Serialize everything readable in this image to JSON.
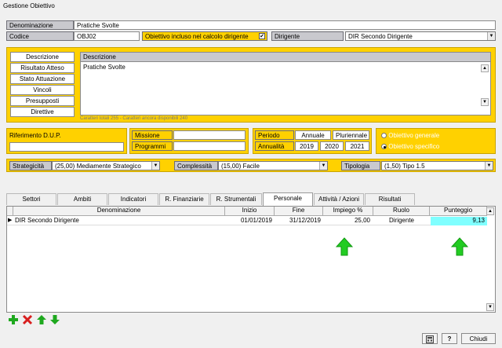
{
  "window": {
    "title": "Gestione Obiettivo"
  },
  "header": {
    "denominazione_label": "Denominazione",
    "denominazione_value": "Pratiche Svolte",
    "codice_label": "Codice",
    "codice_value": "OBJ02",
    "calcolo_label": "Obiettivo incluso nel calcolo dirigente",
    "calcolo_checked": true,
    "dirigente_label": "Dirigente",
    "dirigente_value": "DIR Secondo Dirigente"
  },
  "side_tabs": [
    "Descrizione",
    "Risultato Atteso",
    "Stato Attuazione",
    "Vincoli",
    "Presupposti",
    "Direttive"
  ],
  "descrizione": {
    "header": "Descrizione",
    "text": "Pratiche Svolte",
    "counter": "Caratteri totali 255 - Caratteri ancora disponibili 240"
  },
  "dup": {
    "label": "Riferimento D.U.P.",
    "value": ""
  },
  "missione": {
    "missione_label": "Missione",
    "programmi_label": "Programmi"
  },
  "periodo": {
    "periodo_label": "Periodo",
    "annuale": "Annuale",
    "pluriennale": "Pluriennale",
    "annualita_label": "Annualità",
    "years": [
      "2019",
      "2020",
      "2021"
    ]
  },
  "tipo_obiettivo": {
    "generale": "Obiettivo generale",
    "specifico": "Obiettivo specifico",
    "selected": "specifico"
  },
  "classifiche": {
    "strategicita_label": "Strategicità",
    "strategicita_value": "(25,00) Mediamente Strategico",
    "complessita_label": "Complessità",
    "complessita_value": "(15,00) Facile",
    "tipologia_label": "Tipologia",
    "tipologia_value": "(1,50) Tipo 1.5"
  },
  "tabs": [
    "Settori",
    "Ambiti",
    "Indicatori",
    "R. Finanziarie",
    "R. Strumentali",
    "Personale",
    "Attività / Azioni",
    "Risultati"
  ],
  "active_tab": "Personale",
  "grid": {
    "columns": [
      "Denominazione",
      "Inizio",
      "Fine",
      "Impiego %",
      "Ruolo",
      "Punteggio"
    ],
    "rows": [
      {
        "denominazione": "DIR Secondo Dirigente",
        "inizio": "01/01/2019",
        "fine": "31/12/2019",
        "impiego": "25,00",
        "ruolo": "Dirigente",
        "punteggio": "9,13"
      }
    ]
  },
  "footer": {
    "close_label": "Chiudi"
  },
  "colors": {
    "accent_yellow": "#ffd100",
    "highlight_cyan": "#80ffff",
    "arrow_green": "#22cc22"
  }
}
